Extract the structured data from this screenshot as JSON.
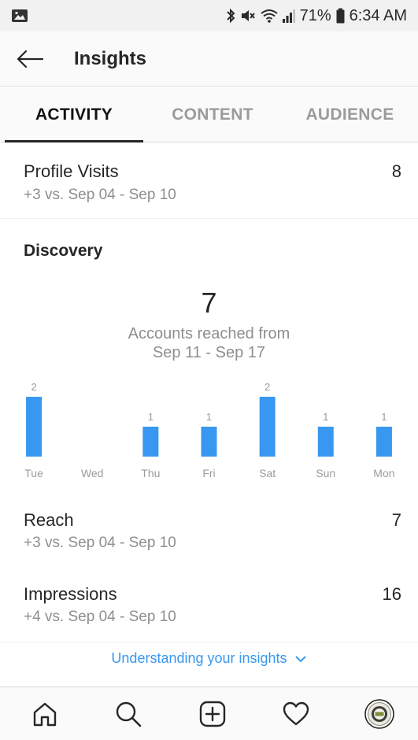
{
  "status_bar": {
    "battery": "71%",
    "time": "6:34 AM",
    "icons": [
      "image-notification-icon",
      "bluetooth-icon",
      "mute-icon",
      "wifi-icon",
      "signal-icon",
      "battery-icon"
    ]
  },
  "header": {
    "title": "Insights",
    "back_icon": "back-arrow-icon"
  },
  "tabs": [
    {
      "label": "ACTIVITY",
      "active": true
    },
    {
      "label": "CONTENT",
      "active": false
    },
    {
      "label": "AUDIENCE",
      "active": false
    }
  ],
  "profile_visits": {
    "label": "Profile Visits",
    "value": "8",
    "comparison": "+3 vs. Sep 04 - Sep 10"
  },
  "discovery": {
    "title": "Discovery",
    "accounts_reached": "7",
    "caption_line1": "Accounts reached from",
    "caption_line2": "Sep 11 - Sep 17"
  },
  "chart_data": {
    "type": "bar",
    "categories": [
      "Tue",
      "Wed",
      "Thu",
      "Fri",
      "Sat",
      "Sun",
      "Mon"
    ],
    "values": [
      2,
      0,
      1,
      1,
      2,
      1,
      1
    ],
    "data_labels": [
      "2",
      "",
      "1",
      "1",
      "2",
      "1",
      "1"
    ],
    "title": "",
    "xlabel": "",
    "ylabel": "",
    "ylim": [
      0,
      2
    ],
    "grid": false,
    "bar_color": "#3897f0"
  },
  "reach": {
    "label": "Reach",
    "value": "7",
    "comparison": "+3 vs. Sep 04 - Sep 10"
  },
  "impressions": {
    "label": "Impressions",
    "value": "16",
    "comparison": "+4 vs. Sep 04 - Sep 10"
  },
  "footer_link": {
    "label": "Understanding your insights",
    "icon": "chevron-down-icon"
  },
  "bottom_nav": [
    "home-icon",
    "search-icon",
    "new-post-icon",
    "activity-heart-icon",
    "profile-avatar"
  ],
  "colors": {
    "accent": "#3897f0",
    "text": "#262626",
    "secondary_text": "#8e8e8e"
  }
}
